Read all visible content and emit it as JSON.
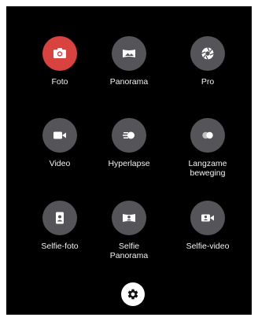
{
  "modes": [
    {
      "label": "Foto",
      "icon": "camera-icon",
      "active": true
    },
    {
      "label": "Panorama",
      "icon": "panorama-icon",
      "active": false
    },
    {
      "label": "Pro",
      "icon": "aperture-icon",
      "active": false
    },
    {
      "label": "Video",
      "icon": "video-camera-icon",
      "active": false
    },
    {
      "label": "Hyperlapse",
      "icon": "hyperlapse-icon",
      "active": false
    },
    {
      "label": "Langzame\nbeweging",
      "icon": "slow-motion-icon",
      "active": false
    },
    {
      "label": "Selfie-foto",
      "icon": "selfie-photo-icon",
      "active": false
    },
    {
      "label": "Selfie\nPanorama",
      "icon": "selfie-panorama-icon",
      "active": false
    },
    {
      "label": "Selfie-video",
      "icon": "selfie-video-icon",
      "active": false
    }
  ],
  "settings": {
    "icon": "gear-icon"
  },
  "colors": {
    "background": "#000000",
    "button": "#545459",
    "active": "#d9433f",
    "label": "#f2f2f2"
  }
}
